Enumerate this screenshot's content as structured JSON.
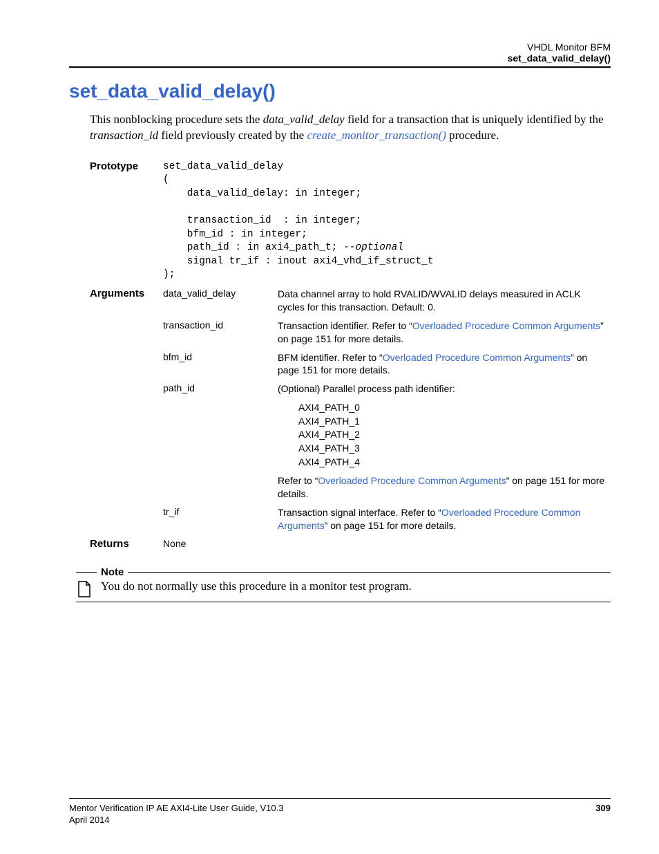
{
  "header": {
    "line1": "VHDL Monitor BFM",
    "line2": "set_data_valid_delay()"
  },
  "title": "set_data_valid_delay()",
  "intro": {
    "pre": "This nonblocking procedure sets the ",
    "field1": "data_valid_delay",
    "mid1": " field for a transaction that is uniquely identified by the ",
    "field2": "transaction_id",
    "mid2": " field previously created by the ",
    "link": "create_monitor_transaction()",
    "post": " procedure."
  },
  "prototype": {
    "label": "Prototype",
    "line1": "set_data_valid_delay",
    "line2": "(",
    "line3": "    data_valid_delay: in integer;",
    "line4": "",
    "line5": "    transaction_id  : in integer;",
    "line6": "    bfm_id : in integer;",
    "line7a": "    path_id : in axi4_path_t; ",
    "line7b": "--optional",
    "line8": "    signal tr_if : inout axi4_vhd_if_struct_t",
    "line9": ");"
  },
  "arguments": {
    "label": "Arguments",
    "rows": [
      {
        "name": "data_valid_delay",
        "desc": "Data channel array to hold RVALID/WVALID delays measured in ACLK cycles for this transaction. Default: 0."
      },
      {
        "name": "transaction_id",
        "desc_pre": "Transaction identifier. Refer to “",
        "link": "Overloaded Procedure Common Arguments",
        "desc_post": "” on page 151 for more details."
      },
      {
        "name": "bfm_id",
        "desc_pre": "BFM identifier. Refer to “",
        "link": "Overloaded Procedure Common Arguments",
        "desc_post": "” on page 151 for more details."
      },
      {
        "name": "path_id",
        "intro": "(Optional) Parallel process path identifier:",
        "paths": [
          "AXI4_PATH_0",
          "AXI4_PATH_1",
          "AXI4_PATH_2",
          "AXI4_PATH_3",
          "AXI4_PATH_4"
        ],
        "trail_pre": "Refer to “",
        "trail_link": "Overloaded Procedure Common Arguments",
        "trail_post": "” on page 151 for more details."
      },
      {
        "name": "tr_if",
        "desc_pre": "Transaction signal interface. Refer to “",
        "link": "Overloaded Procedure Common Arguments",
        "desc_post": "” on page 151 for more details."
      }
    ]
  },
  "returns": {
    "label": "Returns",
    "value": "None"
  },
  "note": {
    "label": "Note",
    "text": "You do not normally use this procedure in a monitor test program."
  },
  "footer": {
    "left1": "Mentor Verification IP AE AXI4-Lite User Guide, V10.3",
    "left2": "April 2014",
    "right": "309"
  }
}
